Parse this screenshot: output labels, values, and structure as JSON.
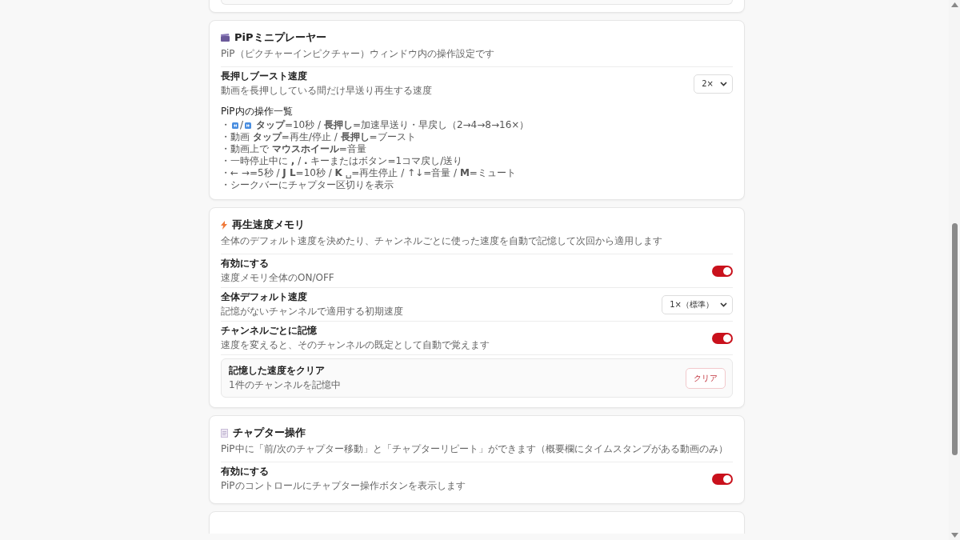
{
  "sections": [
    {
      "title": "PiPミニプレーヤー",
      "description": "PiP（ピクチャーインピクチャー）ウィンドウ内の操作設定です",
      "rows": [
        {
          "kind": "select",
          "label": "長押しブースト速度",
          "hint": "動画を長押ししている間だけ早送り再生する速度",
          "value": "2×"
        }
      ],
      "help": {
        "title": "PiP内の操作一覧",
        "lines": [
          {
            "bullet": "・",
            "icons": true,
            "icon_separator": "/",
            "text": "**タップ**=10秒 / **長押し**=加速早送り・早戻し（2→4→8→16×）"
          },
          {
            "bullet": "・",
            "icons": false,
            "text": "動画 **タップ**=再生/停止 / **長押し**=ブースト"
          },
          {
            "bullet": "・",
            "icons": false,
            "text": "動画上で **マウスホイール**=音量"
          },
          {
            "bullet": "・",
            "icons": false,
            "text": "一時停止中に **,** / **.** キーまたはボタン=1コマ戻し/送り"
          },
          {
            "bullet": "・",
            "icons": false,
            "text": "← →=5秒 / **J L**=10秒 / **K** ␣=再生停止 / ↑↓=音量 / **M**=ミュート"
          },
          {
            "bullet": "・",
            "icons": false,
            "text": "シークバーにチャプター区切りを表示"
          }
        ]
      }
    },
    {
      "title": "再生速度メモリ",
      "description": "全体のデフォルト速度を決めたり、チャンネルごとに使った速度を自動で記憶して次回から適用します",
      "rows": [
        {
          "kind": "toggle",
          "label": "有効にする",
          "hint": "速度メモリ全体のON/OFF",
          "on": true
        },
        {
          "kind": "select",
          "label": "全体デフォルト速度",
          "hint": "記憶がないチャンネルで適用する初期速度",
          "value": "1×（標準）"
        },
        {
          "kind": "toggle",
          "label": "チャンネルごとに記憶",
          "hint": "速度を変えると、そのチャンネルの既定として自動で覚えます",
          "on": true
        },
        {
          "kind": "action",
          "label": "記憶した速度をクリア",
          "hint": "1件のチャンネルを記憶中",
          "button": "クリア"
        }
      ]
    },
    {
      "title": "チャプター操作",
      "description": "PiP中に「前/次のチャプター移動」と「チャプターリピート」ができます（概要欄にタイムスタンプがある動画のみ）",
      "rows": [
        {
          "kind": "toggle",
          "label": "有効にする",
          "hint": "PiPのコントロールにチャプター操作ボタンを表示します",
          "on": true
        }
      ]
    }
  ]
}
